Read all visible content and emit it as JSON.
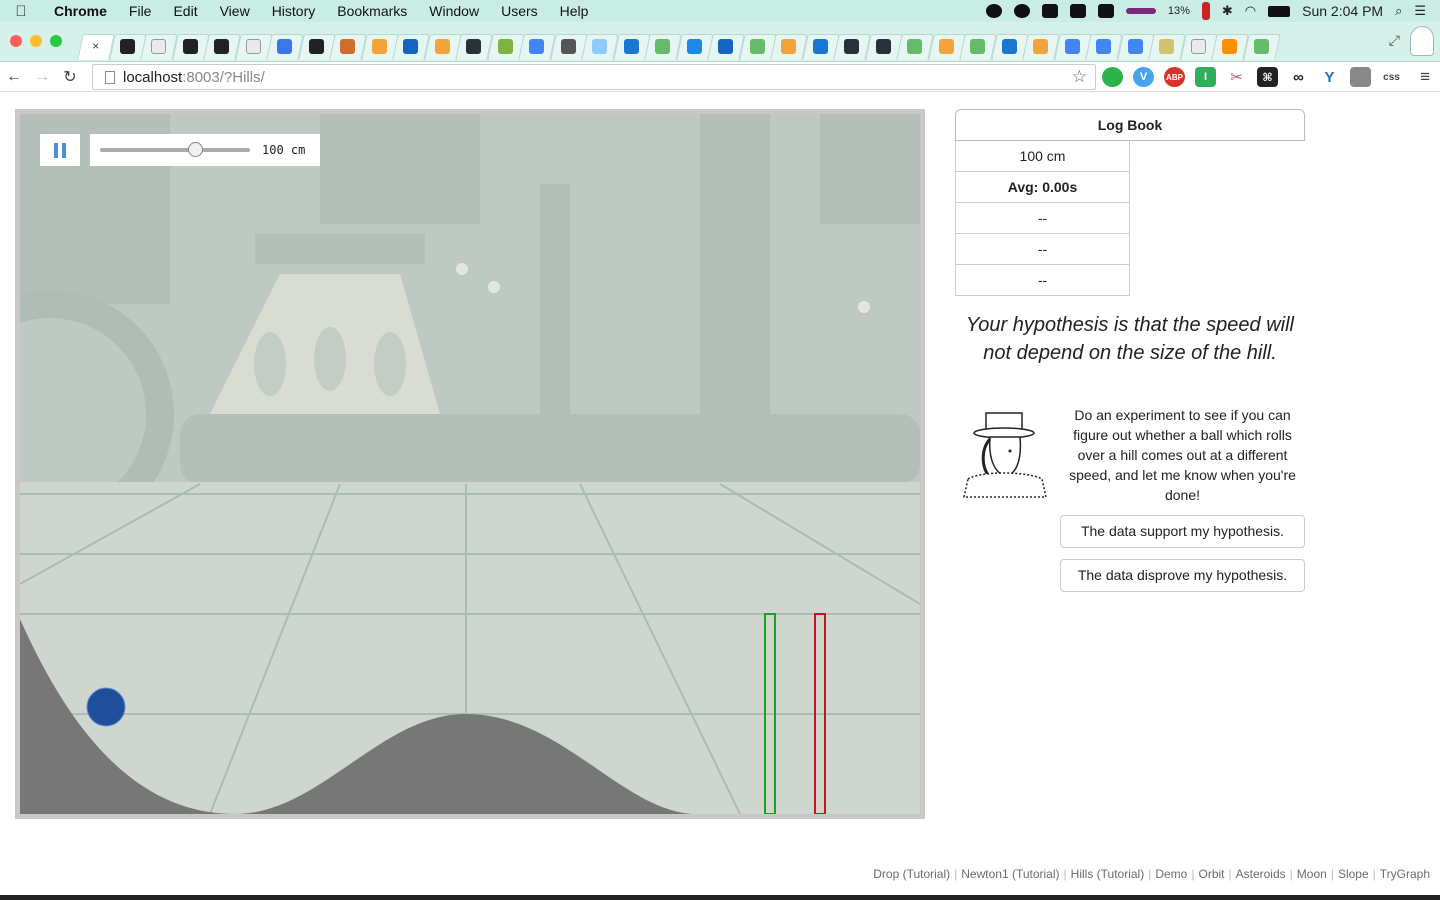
{
  "menubar": {
    "app_name": "Chrome",
    "items": [
      "File",
      "Edit",
      "View",
      "History",
      "Bookmarks",
      "Window",
      "Users",
      "Help"
    ],
    "battery": "13%",
    "clock": "Sun 2:04 PM"
  },
  "browser": {
    "url_host": "localhost",
    "url_path": ":8003/?Hills/",
    "tab_count": 40
  },
  "simulation": {
    "slider_value": "100 cm",
    "slider_fraction": 0.65
  },
  "logbook": {
    "title": "Log Book",
    "header": "100 cm",
    "avg": "Avg: 0.00s",
    "entries": [
      "--",
      "--",
      "--"
    ]
  },
  "hypothesis": "Your hypothesis is that the speed will not depend on the size of the hill.",
  "instructions": "Do an experiment to see if you can figure out whether a ball which rolls over a hill comes out at a different speed, and let me know when you're done!",
  "buttons": {
    "support": "The data support my hypothesis.",
    "disprove": "The data disprove my hypothesis."
  },
  "footer_links": [
    "Drop (Tutorial)",
    "Newton1 (Tutorial)",
    "Hills (Tutorial)",
    "Demo",
    "Orbit",
    "Asteroids",
    "Moon",
    "Slope",
    "TryGraph"
  ],
  "colors": {
    "menubar_bg": "#c9ede5",
    "pause_icon": "#4a8fdb",
    "start_gate": "#1fa01f",
    "finish_gate": "#c01818",
    "ball": "#1f4f9a"
  }
}
